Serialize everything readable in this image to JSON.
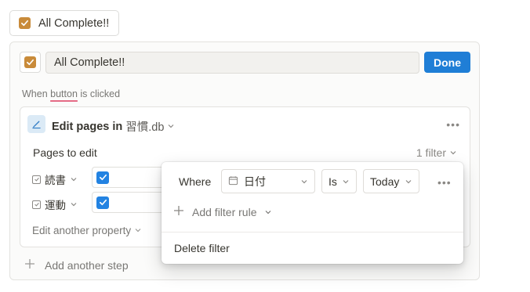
{
  "top_button": {
    "label": "All Complete!!"
  },
  "editor": {
    "name_value": "All Complete!!",
    "done_label": "Done",
    "trigger_prefix": "When ",
    "trigger_link": "button",
    "trigger_suffix": " is clicked"
  },
  "step": {
    "title": "Edit pages in",
    "database": "習慣.db",
    "pages_to_edit": "Pages to edit",
    "filter_count": "1 filter",
    "properties": [
      {
        "name": "読書",
        "checked": true
      },
      {
        "name": "運動",
        "checked": true
      }
    ],
    "edit_another": "Edit another property"
  },
  "add_step": "Add another step",
  "filter_popup": {
    "where": "Where",
    "property": "日付",
    "operator": "Is",
    "value": "Today",
    "add_rule": "Add filter rule",
    "delete": "Delete filter"
  },
  "colors": {
    "accent_blue": "#2383e2",
    "done_blue": "#1f7ed6",
    "checkbox_orange": "#c98b3a",
    "underline_pink": "#e56b86"
  },
  "icons": [
    "checkbox-icon",
    "edit-pen-icon",
    "more-dots-icon",
    "chevron-down-icon",
    "checkbox-property-icon",
    "plus-icon",
    "calendar-icon"
  ]
}
